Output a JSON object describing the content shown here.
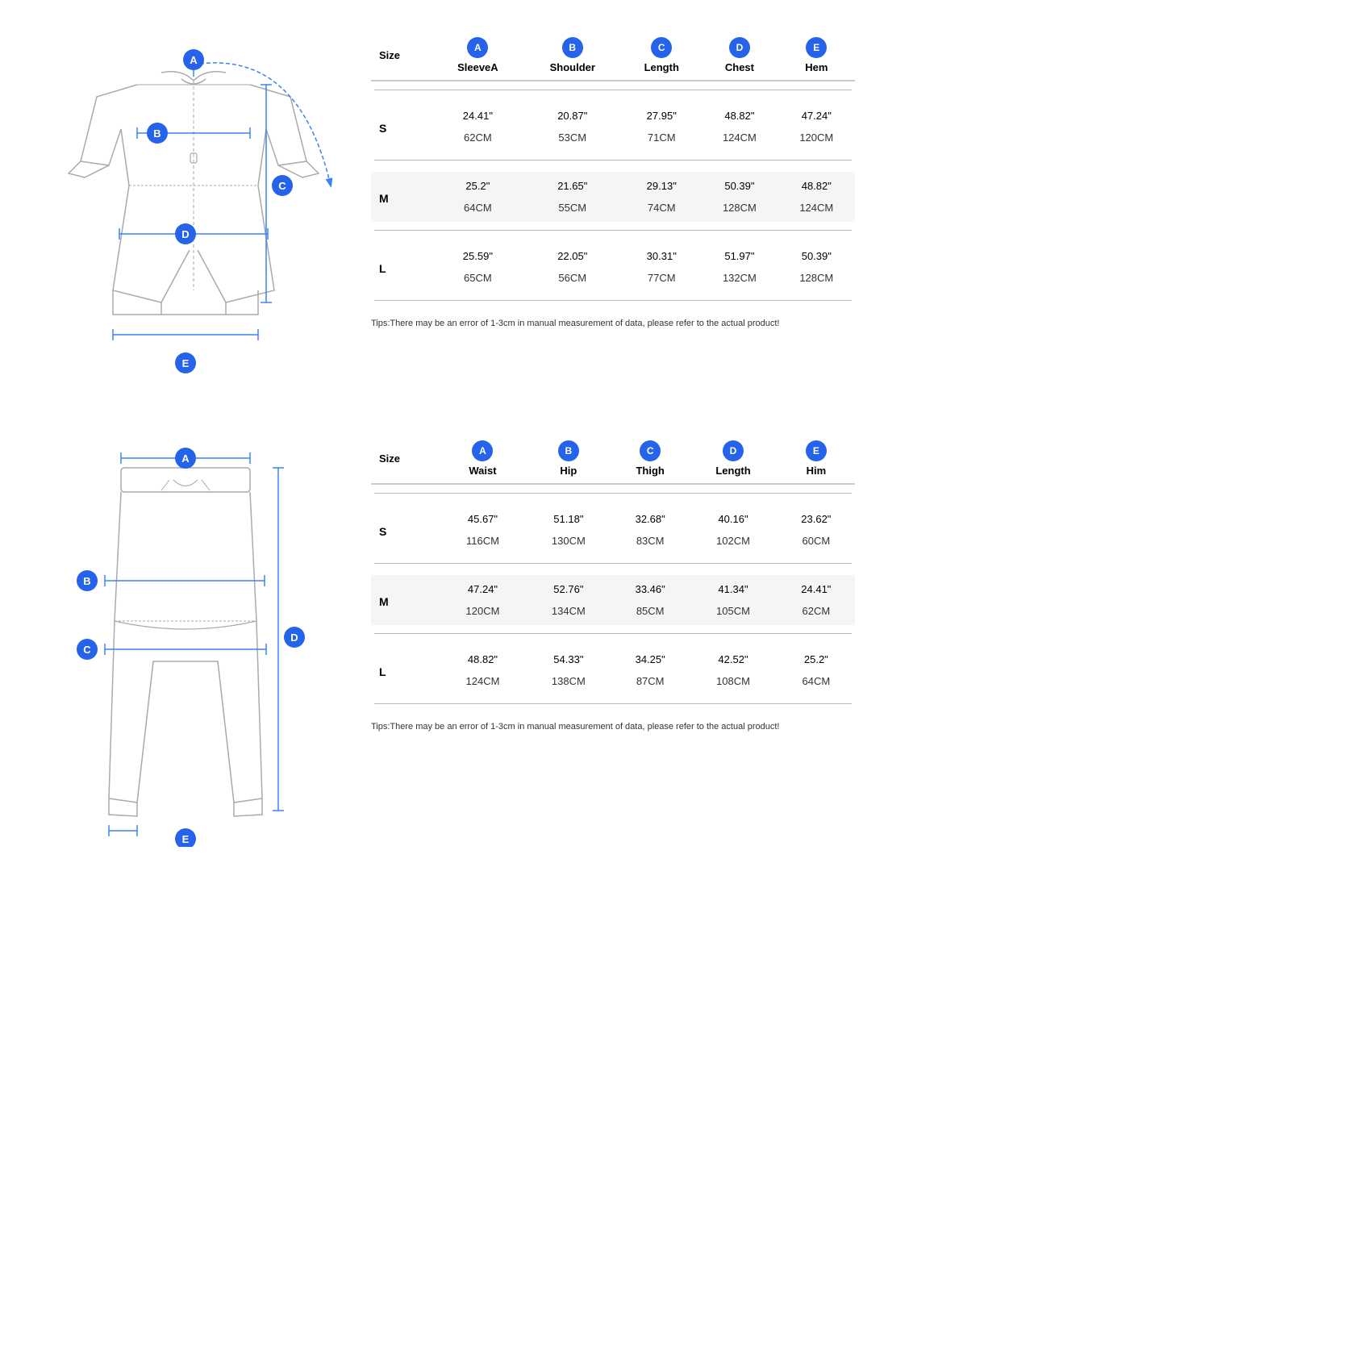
{
  "jacket": {
    "labels": {
      "A": "A",
      "B": "B",
      "C": "C",
      "D": "D",
      "E": "E"
    },
    "table": {
      "columns": [
        "Size",
        "SleeveA",
        "Shoulder",
        "Length",
        "Chest",
        "Hem"
      ],
      "badges": [
        "A",
        "B",
        "C",
        "D",
        "E"
      ],
      "rows": [
        {
          "size": "S",
          "imperial": [
            "24.41\"",
            "20.87\"",
            "27.95\"",
            "48.82\"",
            "47.24\""
          ],
          "metric": [
            "62CM",
            "53CM",
            "71CM",
            "124CM",
            "120CM"
          ],
          "shaded": false
        },
        {
          "size": "M",
          "imperial": [
            "25.2\"",
            "21.65\"",
            "29.13\"",
            "50.39\"",
            "48.82\""
          ],
          "metric": [
            "64CM",
            "55CM",
            "74CM",
            "128CM",
            "124CM"
          ],
          "shaded": true
        },
        {
          "size": "L",
          "imperial": [
            "25.59\"",
            "22.05\"",
            "30.31\"",
            "51.97\"",
            "50.39\""
          ],
          "metric": [
            "65CM",
            "56CM",
            "77CM",
            "132CM",
            "128CM"
          ],
          "shaded": false
        }
      ],
      "tips": "Tips:There may be an error of 1-3cm in manual measurement of data, please refer to the actual product!"
    }
  },
  "pants": {
    "labels": {
      "A": "A",
      "B": "B",
      "C": "C",
      "D": "D",
      "E": "E"
    },
    "table": {
      "columns": [
        "Size",
        "Waist",
        "Hip",
        "Thigh",
        "Length",
        "Him"
      ],
      "badges": [
        "A",
        "B",
        "C",
        "D",
        "E"
      ],
      "rows": [
        {
          "size": "S",
          "imperial": [
            "45.67\"",
            "51.18\"",
            "32.68\"",
            "40.16\"",
            "23.62\""
          ],
          "metric": [
            "116CM",
            "130CM",
            "83CM",
            "102CM",
            "60CM"
          ],
          "shaded": false
        },
        {
          "size": "M",
          "imperial": [
            "47.24\"",
            "52.76\"",
            "33.46\"",
            "41.34\"",
            "24.41\""
          ],
          "metric": [
            "120CM",
            "134CM",
            "85CM",
            "105CM",
            "62CM"
          ],
          "shaded": true
        },
        {
          "size": "L",
          "imperial": [
            "48.82\"",
            "54.33\"",
            "34.25\"",
            "42.52\"",
            "25.2\""
          ],
          "metric": [
            "124CM",
            "138CM",
            "87CM",
            "108CM",
            "64CM"
          ],
          "shaded": false
        }
      ],
      "tips": "Tips:There may be an error of 1-3cm in manual measurement of data, please refer to the actual product!"
    }
  }
}
